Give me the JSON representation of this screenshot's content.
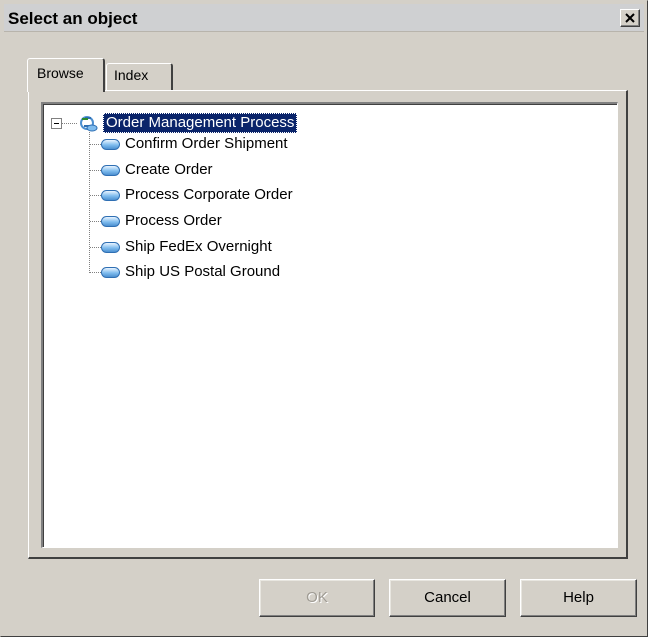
{
  "window": {
    "title": "Select an object",
    "close_icon": "close-icon"
  },
  "tabs": [
    {
      "label": "Browse",
      "active": true
    },
    {
      "label": "Index",
      "active": false
    }
  ],
  "tree": {
    "root": {
      "label": "Order Management Process",
      "icon": "process-model-icon",
      "expanded": true,
      "selected": true
    },
    "children": [
      {
        "label": "Confirm Order Shipment",
        "icon": "process-icon"
      },
      {
        "label": "Create Order",
        "icon": "process-icon"
      },
      {
        "label": "Process Corporate Order",
        "icon": "process-icon"
      },
      {
        "label": "Process Order",
        "icon": "process-icon"
      },
      {
        "label": "Ship FedEx Overnight",
        "icon": "process-icon"
      },
      {
        "label": "Ship US Postal Ground",
        "icon": "process-icon"
      }
    ]
  },
  "buttons": {
    "ok": "OK",
    "cancel": "Cancel",
    "help": "Help"
  },
  "colors": {
    "selection": "#0a246a",
    "dialog_face": "#d4d0c8",
    "node_icon": "#7fbcee"
  }
}
